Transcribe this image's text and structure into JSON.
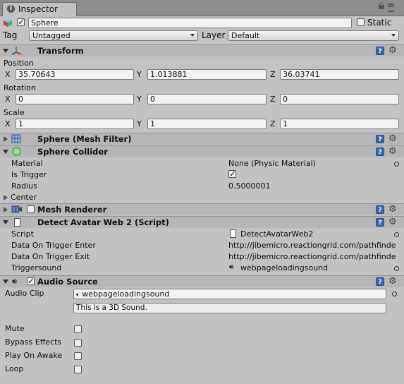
{
  "window": {
    "tab_title": "Inspector"
  },
  "object": {
    "name": "Sphere",
    "static_label": "Static",
    "tag_label": "Tag",
    "tag_value": "Untagged",
    "layer_label": "Layer",
    "layer_value": "Default"
  },
  "transform": {
    "title": "Transform",
    "position_label": "Position",
    "rotation_label": "Rotation",
    "scale_label": "Scale",
    "x_label": "X",
    "y_label": "Y",
    "z_label": "Z",
    "position": {
      "x": "35.70643",
      "y": "1.013881",
      "z": "36.03741"
    },
    "rotation": {
      "x": "0",
      "y": "0",
      "z": "0"
    },
    "scale": {
      "x": "1",
      "y": "1",
      "z": "1"
    }
  },
  "mesh_filter": {
    "title": "Sphere (Mesh Filter)"
  },
  "collider": {
    "title": "Sphere Collider",
    "material_label": "Material",
    "material_value": "None (Physic Material)",
    "is_trigger_label": "Is Trigger",
    "is_trigger": true,
    "radius_label": "Radius",
    "radius_value": "0.5000001",
    "center_label": "Center"
  },
  "mesh_renderer": {
    "title": "Mesh Renderer"
  },
  "script": {
    "title": "Detect Avatar Web 2 (Script)",
    "script_label": "Script",
    "script_value": "DetectAvatarWeb2",
    "enter_label": "Data On Trigger Enter",
    "enter_value": "http://jibemicro.reactiongrid.com/pathfinde",
    "exit_label": "Data On Trigger Exit",
    "exit_value": "http://jibemicro.reactiongrid.com/pathfinde",
    "sound_label": "Triggersound",
    "sound_value": "webpageloadingsound"
  },
  "audio": {
    "title": "Audio Source",
    "clip_label": "Audio Clip",
    "clip_value": "webpageloadingsound",
    "info_text": "This is a 3D Sound.",
    "mute_label": "Mute",
    "bypass_label": "Bypass Effects",
    "play_label": "Play On Awake",
    "loop_label": "Loop"
  },
  "colors": {
    "panel": "#c2c2c2",
    "header": "#b6b6b6",
    "field": "#f2f2f2",
    "help_blue": "#3a68b3"
  },
  "icons": [
    "info-icon",
    "lock-icon",
    "menu-icon",
    "cube-icon",
    "transform-axes-icon",
    "mesh-filter-icon",
    "sphere-collider-icon",
    "mesh-renderer-icon",
    "script-file-icon",
    "audio-speaker-icon",
    "help-icon",
    "gear-icon"
  ]
}
